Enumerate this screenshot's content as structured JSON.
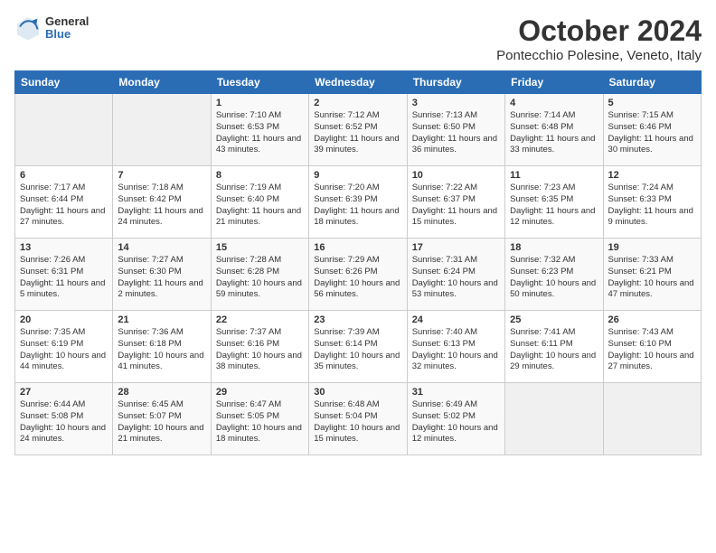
{
  "logo": {
    "general": "General",
    "blue": "Blue"
  },
  "header": {
    "month": "October 2024",
    "location": "Pontecchio Polesine, Veneto, Italy"
  },
  "days_of_week": [
    "Sunday",
    "Monday",
    "Tuesday",
    "Wednesday",
    "Thursday",
    "Friday",
    "Saturday"
  ],
  "weeks": [
    [
      {
        "day": "",
        "info": ""
      },
      {
        "day": "",
        "info": ""
      },
      {
        "day": "1",
        "info": "Sunrise: 7:10 AM\nSunset: 6:53 PM\nDaylight: 11 hours and 43 minutes."
      },
      {
        "day": "2",
        "info": "Sunrise: 7:12 AM\nSunset: 6:52 PM\nDaylight: 11 hours and 39 minutes."
      },
      {
        "day": "3",
        "info": "Sunrise: 7:13 AM\nSunset: 6:50 PM\nDaylight: 11 hours and 36 minutes."
      },
      {
        "day": "4",
        "info": "Sunrise: 7:14 AM\nSunset: 6:48 PM\nDaylight: 11 hours and 33 minutes."
      },
      {
        "day": "5",
        "info": "Sunrise: 7:15 AM\nSunset: 6:46 PM\nDaylight: 11 hours and 30 minutes."
      }
    ],
    [
      {
        "day": "6",
        "info": "Sunrise: 7:17 AM\nSunset: 6:44 PM\nDaylight: 11 hours and 27 minutes."
      },
      {
        "day": "7",
        "info": "Sunrise: 7:18 AM\nSunset: 6:42 PM\nDaylight: 11 hours and 24 minutes."
      },
      {
        "day": "8",
        "info": "Sunrise: 7:19 AM\nSunset: 6:40 PM\nDaylight: 11 hours and 21 minutes."
      },
      {
        "day": "9",
        "info": "Sunrise: 7:20 AM\nSunset: 6:39 PM\nDaylight: 11 hours and 18 minutes."
      },
      {
        "day": "10",
        "info": "Sunrise: 7:22 AM\nSunset: 6:37 PM\nDaylight: 11 hours and 15 minutes."
      },
      {
        "day": "11",
        "info": "Sunrise: 7:23 AM\nSunset: 6:35 PM\nDaylight: 11 hours and 12 minutes."
      },
      {
        "day": "12",
        "info": "Sunrise: 7:24 AM\nSunset: 6:33 PM\nDaylight: 11 hours and 9 minutes."
      }
    ],
    [
      {
        "day": "13",
        "info": "Sunrise: 7:26 AM\nSunset: 6:31 PM\nDaylight: 11 hours and 5 minutes."
      },
      {
        "day": "14",
        "info": "Sunrise: 7:27 AM\nSunset: 6:30 PM\nDaylight: 11 hours and 2 minutes."
      },
      {
        "day": "15",
        "info": "Sunrise: 7:28 AM\nSunset: 6:28 PM\nDaylight: 10 hours and 59 minutes."
      },
      {
        "day": "16",
        "info": "Sunrise: 7:29 AM\nSunset: 6:26 PM\nDaylight: 10 hours and 56 minutes."
      },
      {
        "day": "17",
        "info": "Sunrise: 7:31 AM\nSunset: 6:24 PM\nDaylight: 10 hours and 53 minutes."
      },
      {
        "day": "18",
        "info": "Sunrise: 7:32 AM\nSunset: 6:23 PM\nDaylight: 10 hours and 50 minutes."
      },
      {
        "day": "19",
        "info": "Sunrise: 7:33 AM\nSunset: 6:21 PM\nDaylight: 10 hours and 47 minutes."
      }
    ],
    [
      {
        "day": "20",
        "info": "Sunrise: 7:35 AM\nSunset: 6:19 PM\nDaylight: 10 hours and 44 minutes."
      },
      {
        "day": "21",
        "info": "Sunrise: 7:36 AM\nSunset: 6:18 PM\nDaylight: 10 hours and 41 minutes."
      },
      {
        "day": "22",
        "info": "Sunrise: 7:37 AM\nSunset: 6:16 PM\nDaylight: 10 hours and 38 minutes."
      },
      {
        "day": "23",
        "info": "Sunrise: 7:39 AM\nSunset: 6:14 PM\nDaylight: 10 hours and 35 minutes."
      },
      {
        "day": "24",
        "info": "Sunrise: 7:40 AM\nSunset: 6:13 PM\nDaylight: 10 hours and 32 minutes."
      },
      {
        "day": "25",
        "info": "Sunrise: 7:41 AM\nSunset: 6:11 PM\nDaylight: 10 hours and 29 minutes."
      },
      {
        "day": "26",
        "info": "Sunrise: 7:43 AM\nSunset: 6:10 PM\nDaylight: 10 hours and 27 minutes."
      }
    ],
    [
      {
        "day": "27",
        "info": "Sunrise: 6:44 AM\nSunset: 5:08 PM\nDaylight: 10 hours and 24 minutes."
      },
      {
        "day": "28",
        "info": "Sunrise: 6:45 AM\nSunset: 5:07 PM\nDaylight: 10 hours and 21 minutes."
      },
      {
        "day": "29",
        "info": "Sunrise: 6:47 AM\nSunset: 5:05 PM\nDaylight: 10 hours and 18 minutes."
      },
      {
        "day": "30",
        "info": "Sunrise: 6:48 AM\nSunset: 5:04 PM\nDaylight: 10 hours and 15 minutes."
      },
      {
        "day": "31",
        "info": "Sunrise: 6:49 AM\nSunset: 5:02 PM\nDaylight: 10 hours and 12 minutes."
      },
      {
        "day": "",
        "info": ""
      },
      {
        "day": "",
        "info": ""
      }
    ]
  ]
}
